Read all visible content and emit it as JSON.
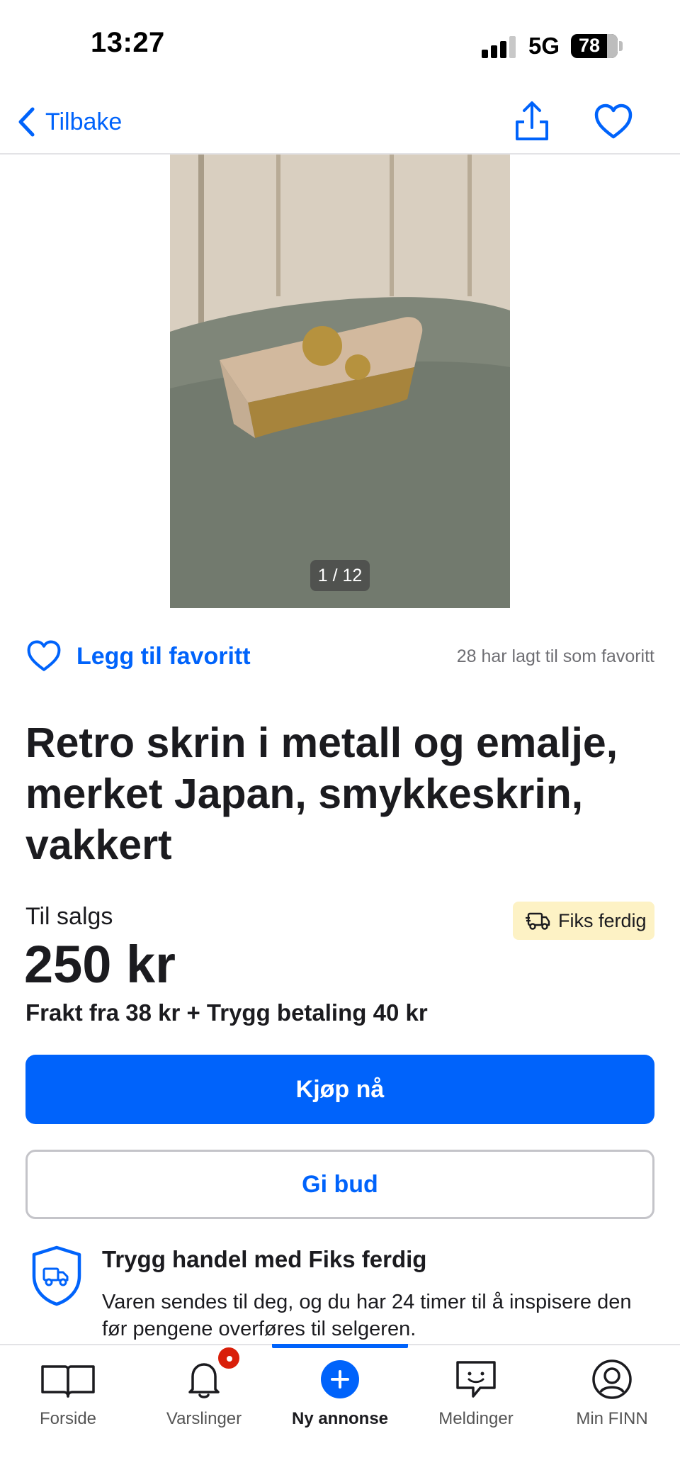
{
  "status_bar": {
    "time": "13:27",
    "network": "5G",
    "battery": "78",
    "battery_level": 0.78
  },
  "nav": {
    "back_label": "Tilbake"
  },
  "gallery": {
    "counter": "1 / 12"
  },
  "favorite": {
    "label": "Legg til favoritt",
    "count_text": "28 har lagt til som favoritt"
  },
  "listing": {
    "title": "Retro skrin i metall og emalje, merket Japan, smykkeskrin, vakkert",
    "status": "Til salgs",
    "badge": "Fiks ferdig",
    "price": "250 kr",
    "shipping": "Frakt fra 38 kr + Trygg betaling 40 kr"
  },
  "actions": {
    "buy_label": "Kjøp nå",
    "bid_label": "Gi bud"
  },
  "safe_trade": {
    "title": "Trygg handel med Fiks ferdig",
    "text": "Varen sendes til deg, og du har 24 timer til å inspisere den før pengene overføres til selgeren."
  },
  "tabs": [
    {
      "label": "Forside",
      "icon": "book-icon"
    },
    {
      "label": "Varslinger",
      "icon": "bell-icon"
    },
    {
      "label": "Ny annonse",
      "icon": "plus-circle-icon"
    },
    {
      "label": "Meldinger",
      "icon": "chat-icon"
    },
    {
      "label": "Min FINN",
      "icon": "profile-icon"
    }
  ],
  "colors": {
    "accent": "#0063fb",
    "badge_bg": "#fdf2c5",
    "notification": "#d91f0a"
  }
}
